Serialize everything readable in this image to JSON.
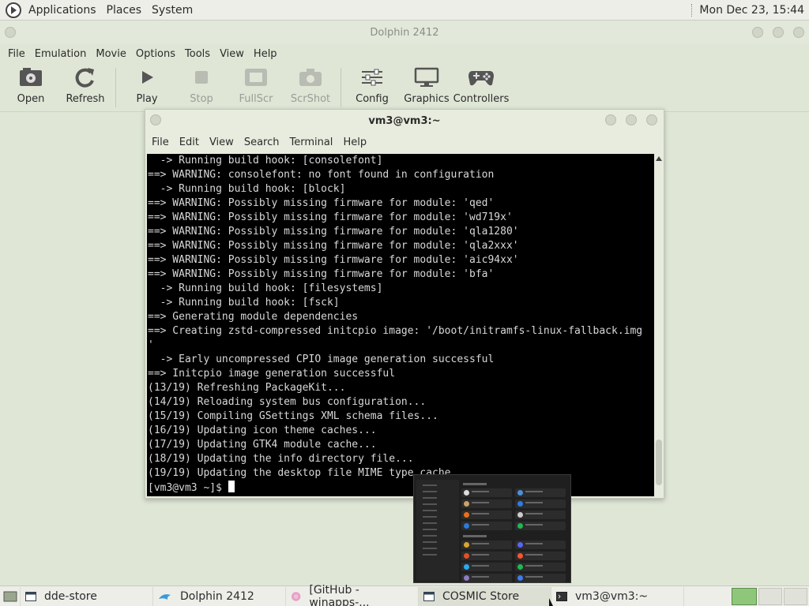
{
  "top_panel": {
    "menus": [
      "Applications",
      "Places",
      "System"
    ],
    "clock": "Mon Dec 23, 15:44"
  },
  "dolphin": {
    "title": "Dolphin 2412",
    "menu": [
      "File",
      "Emulation",
      "Movie",
      "Options",
      "Tools",
      "View",
      "Help"
    ],
    "toolbar": [
      {
        "label": "Open",
        "icon": "disc-icon",
        "enabled": true
      },
      {
        "label": "Refresh",
        "icon": "refresh-icon",
        "enabled": true
      },
      {
        "label": "Play",
        "icon": "play-icon",
        "enabled": true
      },
      {
        "label": "Stop",
        "icon": "stop-icon",
        "enabled": false
      },
      {
        "label": "FullScr",
        "icon": "fullscreen-icon",
        "enabled": false
      },
      {
        "label": "ScrShot",
        "icon": "camera-icon",
        "enabled": false
      },
      {
        "label": "Config",
        "icon": "sliders-icon",
        "enabled": true
      },
      {
        "label": "Graphics",
        "icon": "monitor-icon",
        "enabled": true
      },
      {
        "label": "Controllers",
        "icon": "gamepad-icon",
        "enabled": true
      }
    ]
  },
  "terminal": {
    "title": "vm3@vm3:~",
    "menu": [
      "File",
      "Edit",
      "View",
      "Search",
      "Terminal",
      "Help"
    ],
    "lines": [
      "  -> Running build hook: [consolefont]",
      "==> WARNING: consolefont: no font found in configuration",
      "  -> Running build hook: [block]",
      "==> WARNING: Possibly missing firmware for module: 'qed'",
      "==> WARNING: Possibly missing firmware for module: 'wd719x'",
      "==> WARNING: Possibly missing firmware for module: 'qla1280'",
      "==> WARNING: Possibly missing firmware for module: 'qla2xxx'",
      "==> WARNING: Possibly missing firmware for module: 'aic94xx'",
      "==> WARNING: Possibly missing firmware for module: 'bfa'",
      "  -> Running build hook: [filesystems]",
      "  -> Running build hook: [fsck]",
      "==> Generating module dependencies",
      "==> Creating zstd-compressed initcpio image: '/boot/initramfs-linux-fallback.img",
      "'",
      "  -> Early uncompressed CPIO image generation successful",
      "==> Initcpio image generation successful",
      "(13/19) Refreshing PackageKit...",
      "(14/19) Reloading system bus configuration...",
      "(15/19) Compiling GSettings XML schema files...",
      "(16/19) Updating icon theme caches...",
      "(17/19) Updating GTK4 module cache...",
      "(18/19) Updating the info directory file...",
      "(19/19) Updating the desktop file MIME type cache..."
    ],
    "prompt": "[vm3@vm3 ~]$ "
  },
  "taskbar": {
    "tasks": [
      {
        "label": "dde-store",
        "icon": "window-icon",
        "active": false
      },
      {
        "label": "Dolphin 2412",
        "icon": "dolphin-icon",
        "active": false
      },
      {
        "label": "[GitHub - winapps-...",
        "icon": "browser-icon",
        "active": false
      },
      {
        "label": "COSMIC Store",
        "icon": "window-icon",
        "active": true
      },
      {
        "label": "vm3@vm3:~",
        "icon": "terminal-icon",
        "active": false
      }
    ]
  },
  "colors": {
    "workspace_active": "#8fc77a",
    "terminal_bg": "#000000",
    "panel_bg": "#edeee8"
  }
}
